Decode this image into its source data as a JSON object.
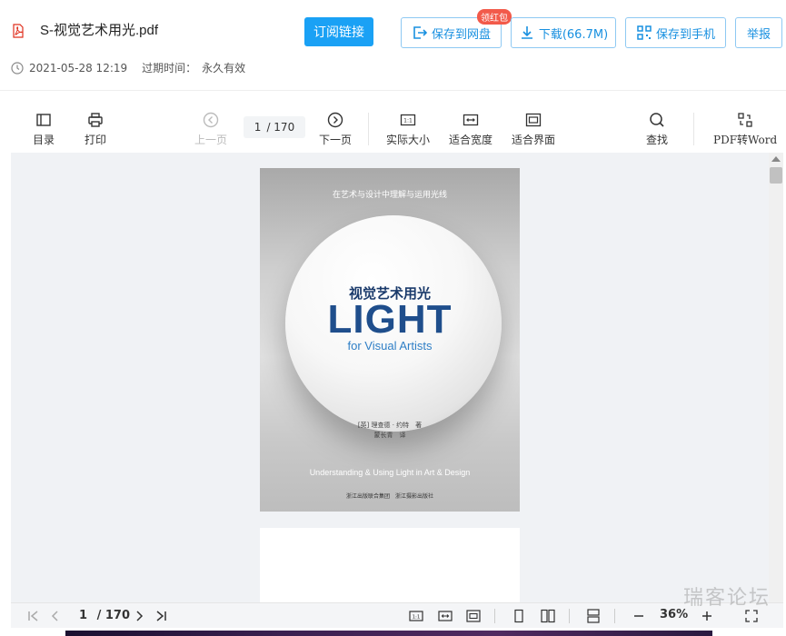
{
  "header": {
    "file_name": "S-视觉艺术用光.pdf",
    "date": "2021-05-28 12:19",
    "expire_label": "过期时间：",
    "expire_value": "永久有效",
    "subscribe_label": "订阅链接",
    "save_to_drive_label": "保存到网盘",
    "red_packet_badge": "领红包",
    "download_label": "下载(66.7M)",
    "save_to_phone_label": "保存到手机",
    "report_label": "举报"
  },
  "toolbar": {
    "toc_label": "目录",
    "print_label": "打印",
    "prev_label": "上一页",
    "current_page": "1",
    "total_pages": "/ 170",
    "next_label": "下一页",
    "actual_size_label": "实际大小",
    "fit_width_label": "适合宽度",
    "fit_page_label": "适合界面",
    "search_label": "查找",
    "pdf_to_word_label": "PDF转Word"
  },
  "cover": {
    "top_line": "在艺术与设计中理解与运用光线",
    "cn_title": "视觉艺术用光",
    "big_title": "LIGHT",
    "subtitle": "for Visual Artists",
    "author_line1": "[英] 理查德 · 约特　著",
    "author_line2": "蒙长青　译",
    "english_line": "Understanding & Using Light in Art & Design",
    "publisher": "浙江出版联合集团　浙江摄影出版社"
  },
  "bottombar": {
    "current_page": "1",
    "total_pages": "/ 170",
    "zoom": "36%"
  },
  "watermark": "瑞客论坛",
  "colors": {
    "accent": "#1aa1f5",
    "badge": "#f25a4a",
    "viewer_bg": "#f0f2f5"
  }
}
